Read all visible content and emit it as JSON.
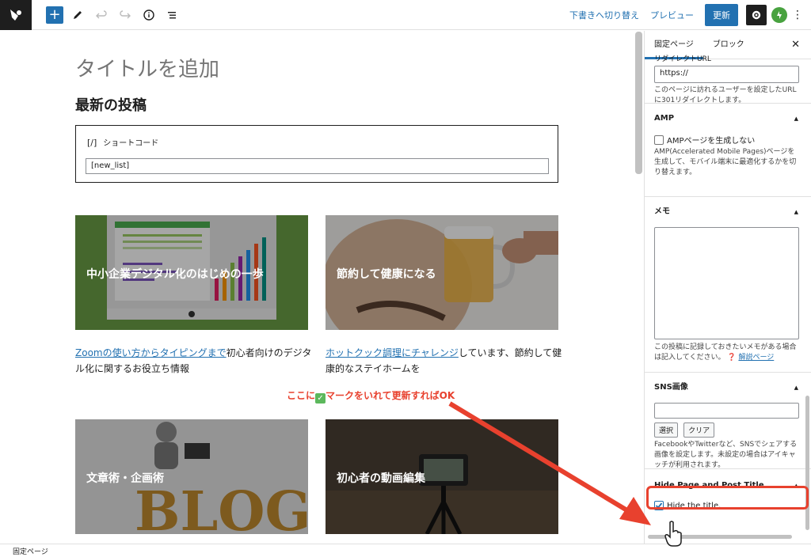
{
  "toolbar": {
    "save_draft": "下書きへ切り替え",
    "preview": "プレビュー",
    "update": "更新"
  },
  "editor": {
    "title_placeholder": "タイトルを追加",
    "heading": "最新の投稿",
    "shortcode": {
      "icon": "[/]",
      "label": "ショートコード",
      "value": "[new_list]"
    },
    "cards": [
      {
        "label": "中小企業デジタル化のはじめの一歩",
        "link": "Zoomの使い方からタイピングまで",
        "desc": "初心者向けのデジタル化に関するお役立ち情報"
      },
      {
        "label": "節約して健康になる",
        "link": "ホットクック調理にチャレンジ",
        "desc": "しています、節約して健康的なステイホームを"
      },
      {
        "label": "文章術・企画術"
      },
      {
        "label": "初心者の動画編集"
      }
    ]
  },
  "sidebar": {
    "tab_page": "固定ページ",
    "tab_block": "ブロック",
    "redirect": {
      "title": "リダイレクトURL",
      "value": "https://",
      "help": "このページに訪れるユーザーを設定したURLに301リダイレクトします。"
    },
    "amp": {
      "title": "AMP",
      "checkbox": "AMPページを生成しない",
      "help": "AMP(Accelerated Mobile Pages)ページを生成して、モバイル端末に最適化するかを切り替えます。"
    },
    "memo": {
      "title": "メモ",
      "help": "この投稿に記録しておきたいメモがある場合は記入してください。",
      "help_link": "解説ページ"
    },
    "sns": {
      "title": "SNS画像",
      "select": "選択",
      "clear": "クリア",
      "help": "FacebookやTwitterなど、SNSでシェアする画像を設定します。未設定の場合はアイキャッチが利用されます。"
    },
    "hide_title": {
      "title": "Hide Page and Post Title",
      "checkbox": "Hide the title."
    }
  },
  "footer": {
    "breadcrumb": "固定ページ"
  },
  "annotation": {
    "before": "ここに",
    "after": "マークをいれて更新すればOK"
  },
  "colors": {
    "accent": "#2271b1",
    "annotation": "#e8412e"
  }
}
